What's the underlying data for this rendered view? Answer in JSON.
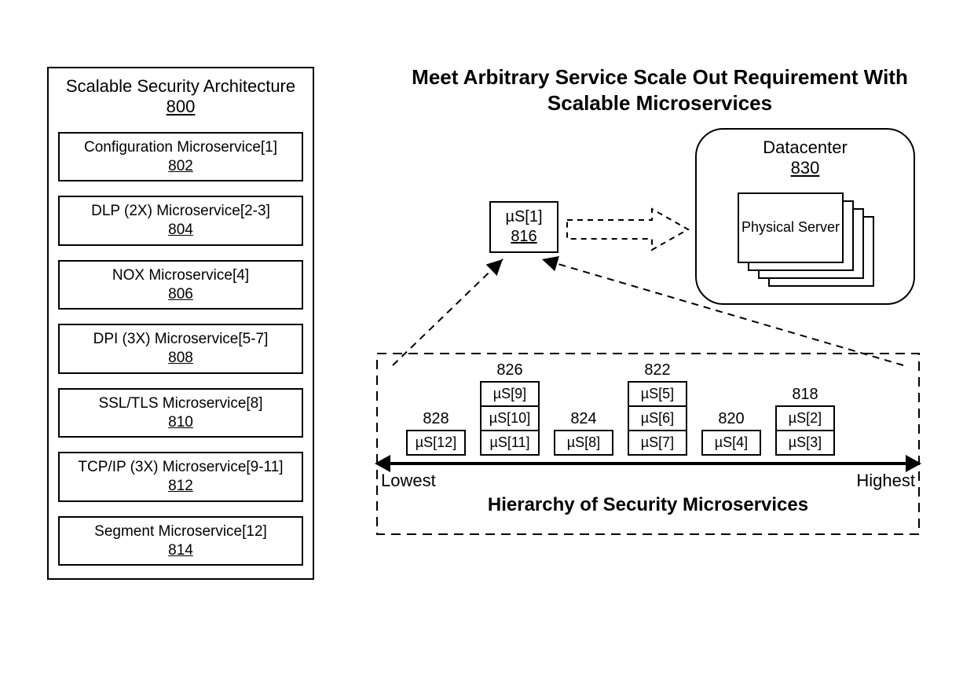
{
  "left_panel": {
    "title": "Scalable Security Architecture",
    "ref": "800",
    "items": [
      {
        "label": "Configuration Microservice[1]",
        "ref": "802"
      },
      {
        "label": "DLP (2X) Microservice[2-3]",
        "ref": "804"
      },
      {
        "label": "NOX Microservice[4]",
        "ref": "806"
      },
      {
        "label": "DPI (3X) Microservice[5-7]",
        "ref": "808"
      },
      {
        "label": "SSL/TLS Microservice[8]",
        "ref": "810"
      },
      {
        "label": "TCP/IP (3X) Microservice[9-11]",
        "ref": "812"
      },
      {
        "label": "Segment Microservice[12]",
        "ref": "814"
      }
    ]
  },
  "right_heading": "Meet Arbitrary Service Scale Out Requirement With Scalable Microservices",
  "datacenter": {
    "title": "Datacenter",
    "ref": "830",
    "server_label": "Physical Server"
  },
  "us1": {
    "label": "µS[1]",
    "ref": "816"
  },
  "hierarchy": {
    "caption": "Hierarchy of Security Microservices",
    "low_label": "Lowest",
    "high_label": "Highest",
    "columns": [
      {
        "ref": "828",
        "cells": [
          "µS[12]"
        ]
      },
      {
        "ref": "826",
        "cells": [
          "µS[9]",
          "µS[10]",
          "µS[11]"
        ]
      },
      {
        "ref": "824",
        "cells": [
          "µS[8]"
        ]
      },
      {
        "ref": "822",
        "cells": [
          "µS[5]",
          "µS[6]",
          "µS[7]"
        ]
      },
      {
        "ref": "820",
        "cells": [
          "µS[4]"
        ]
      },
      {
        "ref": "818",
        "cells": [
          "µS[2]",
          "µS[3]"
        ]
      }
    ]
  }
}
